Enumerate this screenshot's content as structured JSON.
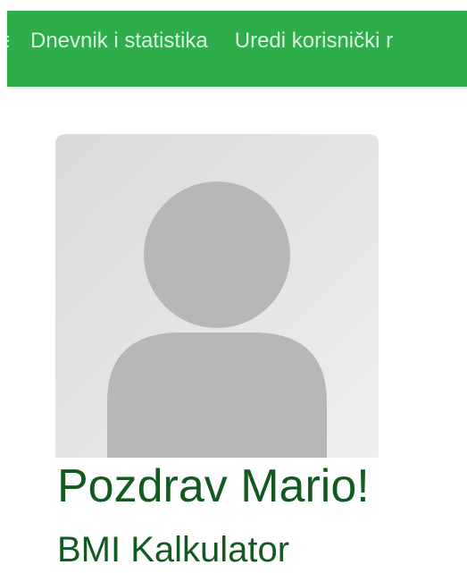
{
  "nav": {
    "items": [
      {
        "label": "a"
      },
      {
        "label": "Dnevnik i statistika"
      },
      {
        "label": "Uredi korisnički r"
      }
    ]
  },
  "profile": {
    "avatar_icon": "user-placeholder-icon",
    "greeting": "Pozdrav Mario!",
    "section_title": "BMI Kalkulator"
  },
  "colors": {
    "navbar_bg": "#2ead4b",
    "nav_text": "#d8f3dc",
    "heading_text": "#125a20",
    "avatar_silhouette": "#b6b7b8"
  }
}
